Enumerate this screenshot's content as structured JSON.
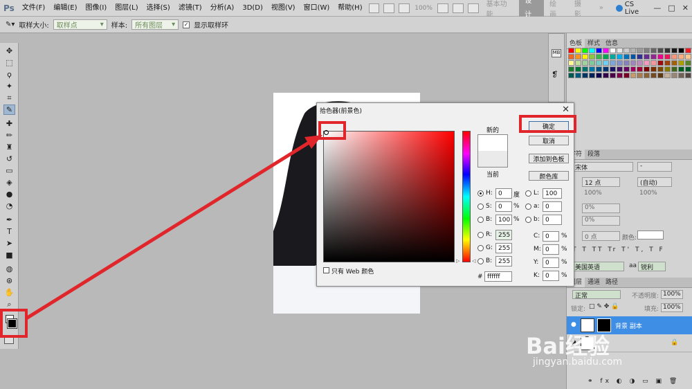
{
  "app": {
    "logo": "Ps"
  },
  "menu": [
    "文件(F)",
    "编辑(E)",
    "图像(I)",
    "图层(L)",
    "选择(S)",
    "滤镜(T)",
    "分析(A)",
    "3D(D)",
    "视图(V)",
    "窗口(W)",
    "帮助(H)"
  ],
  "zoom": "100%",
  "workspaces": [
    "基本功能",
    "设计",
    "绘画",
    "摄影"
  ],
  "cs_live": "CS Live",
  "window_controls": [
    "—",
    "□",
    "✕"
  ],
  "options": {
    "sample_size_label": "取样大小:",
    "sample_size_value": "取样点",
    "sample_label": "样本:",
    "sample_value": "所有图层",
    "show_ring_label": "显示取样环"
  },
  "panels": {
    "swatches_tabs": [
      "色板",
      "样式",
      "信息"
    ],
    "char_tabs": [
      "字符",
      "段落"
    ],
    "font": "宋体",
    "font_style": "-",
    "size": "12 点",
    "leading": "(自动)",
    "scale_v": "100%",
    "scale_h": "100%",
    "tracking": "0%",
    "baseline": "0 点",
    "color_label": "颜色:",
    "language": "美国英语",
    "aa_label": "aa",
    "aa_value": "锐利",
    "layers_tabs": [
      "图层",
      "通道",
      "路径"
    ],
    "blend_mode": "正常",
    "opacity_label": "不透明度:",
    "opacity_value": "100%",
    "lock_label": "锁定:",
    "fill_label": "填充:",
    "fill_value": "100%",
    "layer_name": "背景 副本"
  },
  "dialog": {
    "title": "拾色器(前景色)",
    "new_label": "新的",
    "current_label": "当前",
    "ok": "确定",
    "cancel": "取消",
    "add_swatch": "添加到色板",
    "color_libraries": "颜色库",
    "h_label": "H:",
    "h_value": "0",
    "h_unit": "度",
    "s_label": "S:",
    "s_value": "0",
    "s_unit": "%",
    "b_label": "B:",
    "b_value": "100",
    "b_unit": "%",
    "r_label": "R:",
    "r_value": "255",
    "g_label": "G:",
    "g_value": "255",
    "bl_label": "B:",
    "bl_value": "255",
    "l_label": "L:",
    "l_value": "100",
    "a_label": "a:",
    "a_value": "0",
    "lb_label": "b:",
    "lb_value": "0",
    "c_label": "C:",
    "c_value": "0",
    "c_unit": "%",
    "m_label": "M:",
    "m_value": "0",
    "m_unit": "%",
    "y_label": "Y:",
    "y_value": "0",
    "y_unit": "%",
    "k_label": "K:",
    "k_value": "0",
    "k_unit": "%",
    "hex_label": "#",
    "hex_value": "ffffff",
    "web_only_label": "只有 Web 颜色",
    "new_color": "#ffffff",
    "current_color": "#eaeaea"
  },
  "colors": {
    "accent_red": "#e0262a",
    "layer_selected": "#3f8ee6"
  },
  "watermark": {
    "brand": "Bai经验",
    "url": "jingyan.baidu.com"
  }
}
